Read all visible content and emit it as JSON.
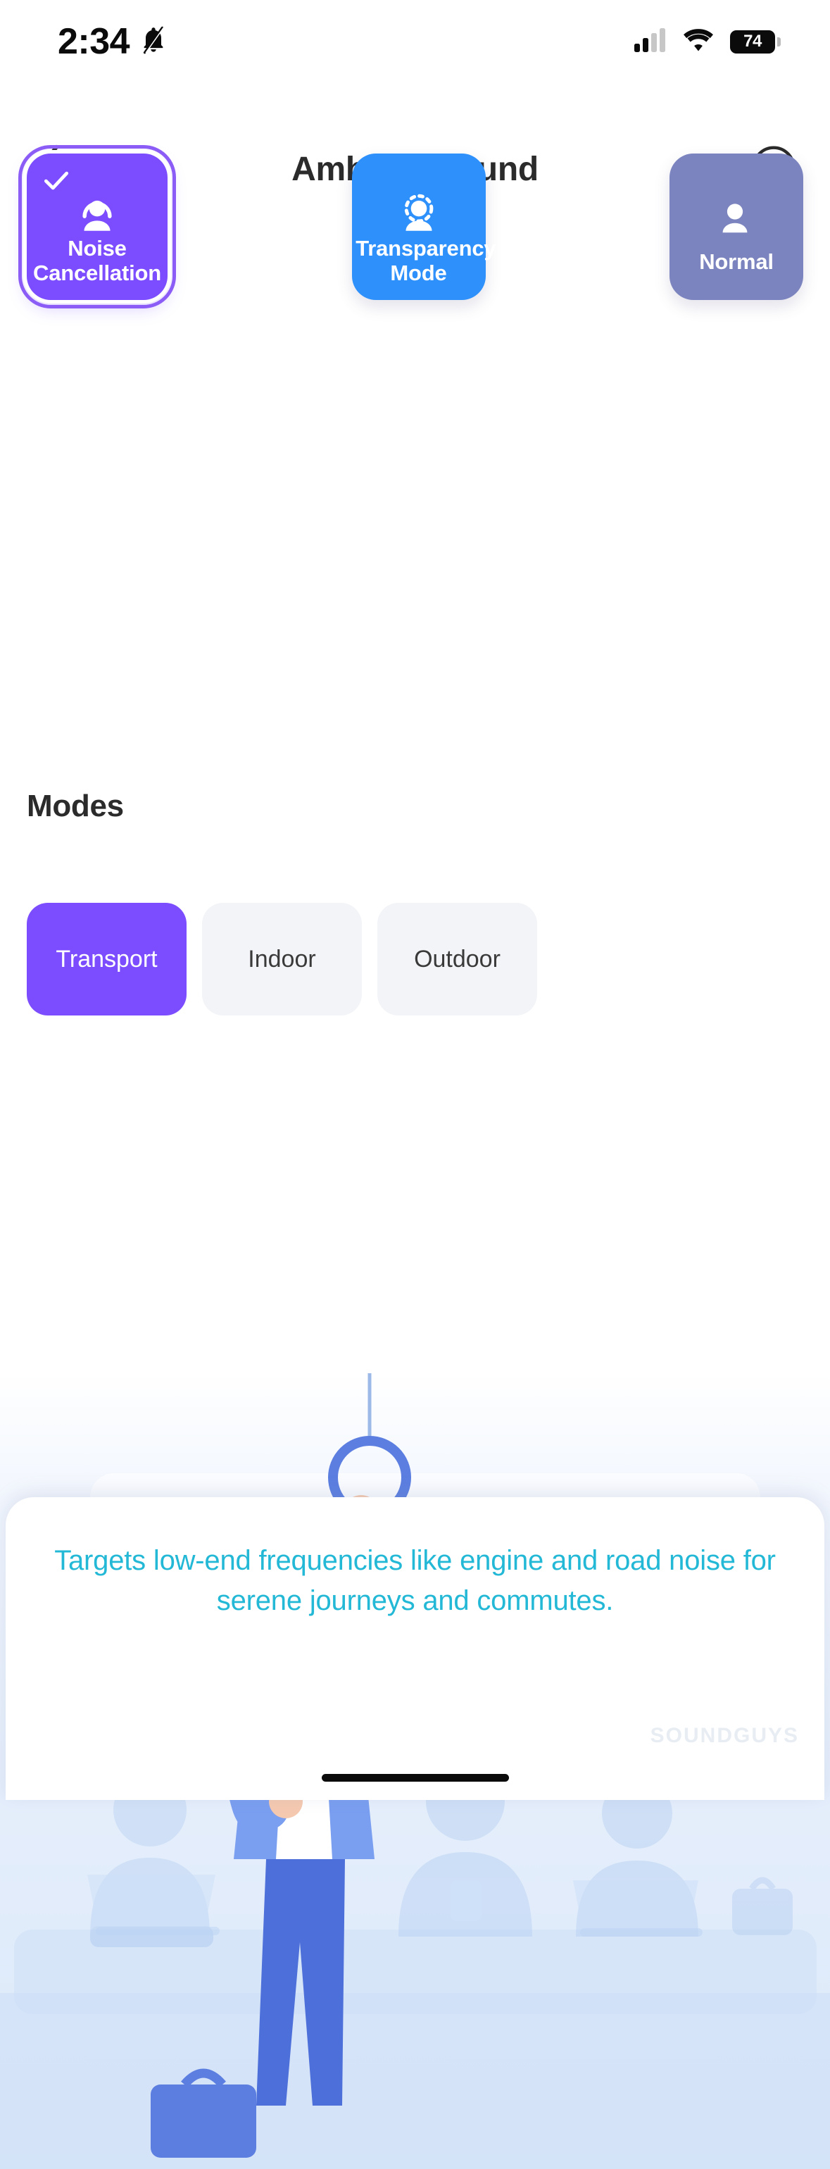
{
  "status_bar": {
    "time": "2:34",
    "bell_icon": "bell-muted-icon",
    "signal_icon": "cellular-signal-icon",
    "wifi_icon": "wifi-icon",
    "battery_percent": "74"
  },
  "header": {
    "back_icon": "chevron-left-icon",
    "title": "Ambient Sound",
    "info_icon": "info-circle-icon"
  },
  "anc_cards": [
    {
      "label": "Noise Cancellation",
      "icon": "person-solid-ring-icon",
      "selected": true,
      "bg": "#7C4DFF",
      "ring": "#8B5CF6",
      "check_icon": "check-icon"
    },
    {
      "label": "Transparency Mode",
      "icon": "person-dashed-ring-icon",
      "selected": false,
      "bg": "#2E90FA"
    },
    {
      "label": "Normal",
      "icon": "person-plain-icon",
      "selected": false,
      "bg": "#7B84BE"
    }
  ],
  "modes": {
    "heading": "Modes",
    "options": [
      {
        "label": "Transport",
        "active": true
      },
      {
        "label": "Indoor",
        "active": false
      },
      {
        "label": "Outdoor",
        "active": false
      }
    ],
    "active_color": "#7C4DFF",
    "inactive_color": "#F2F4F7"
  },
  "illustration": {
    "name": "commuter-on-transit-illustration",
    "description": "Person wearing headphones holding a hanging strap on public transport with faded passengers in background"
  },
  "description": {
    "text": "Targets low-end frequencies like engine and road noise for serene journeys and commutes.",
    "color": "#22B8D6"
  },
  "watermark": {
    "text": "SOUNDGUYS"
  }
}
